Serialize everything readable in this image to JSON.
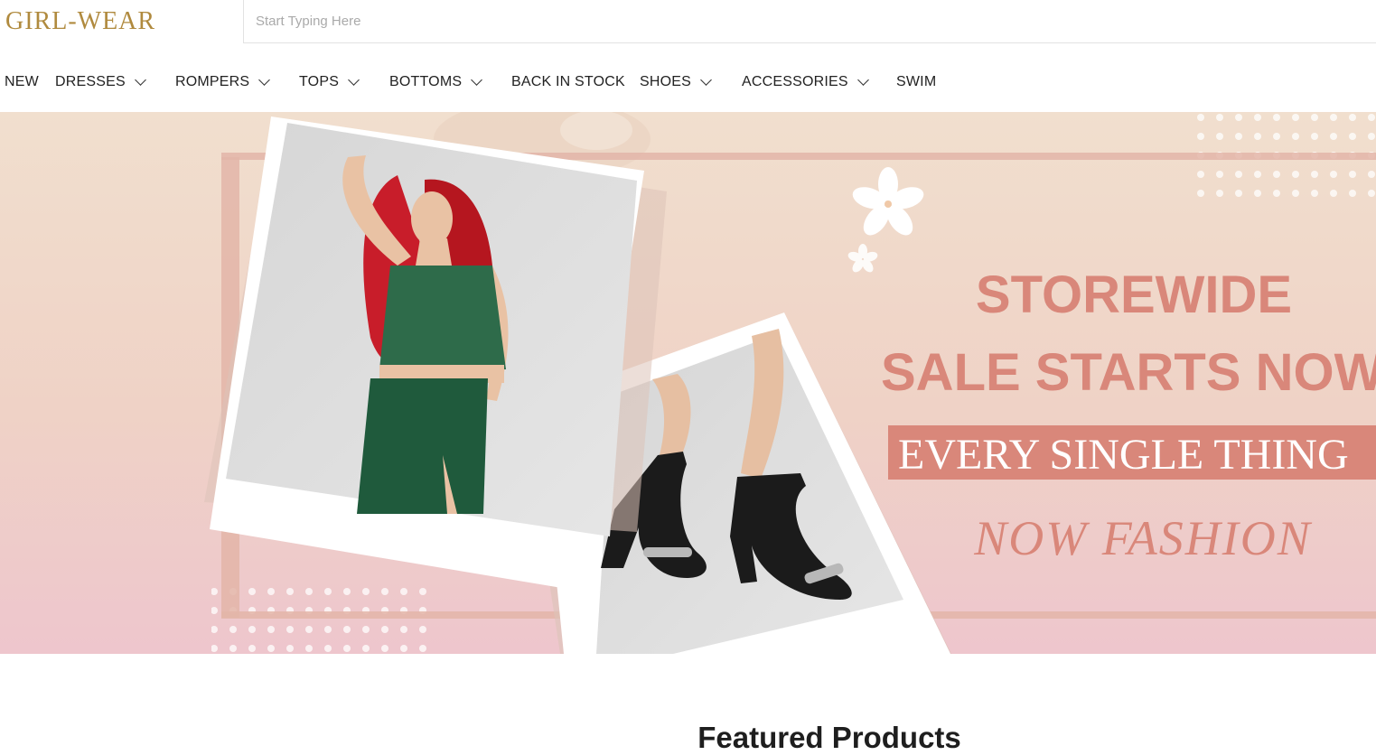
{
  "brand": {
    "logo_text": "GIRL-WEAR",
    "logo_color": "#b08a3e"
  },
  "search": {
    "placeholder": "Start Typing Here",
    "value": ""
  },
  "nav": {
    "items": [
      {
        "label": "NEW",
        "has_dropdown": false
      },
      {
        "label": "DRESSES",
        "has_dropdown": true
      },
      {
        "label": "ROMPERS",
        "has_dropdown": true
      },
      {
        "label": "TOPS",
        "has_dropdown": true
      },
      {
        "label": "BOTTOMS",
        "has_dropdown": true
      },
      {
        "label": "BACK IN STOCK",
        "has_dropdown": false
      },
      {
        "label": "SHOES",
        "has_dropdown": true
      },
      {
        "label": "ACCESSORIES",
        "has_dropdown": true
      },
      {
        "label": "SWIM",
        "has_dropdown": false
      }
    ]
  },
  "hero": {
    "headline_1": "STOREWIDE",
    "headline_2": "SALE STARTS NOW",
    "banner_text": "EVERY SINGLE THING",
    "script_text": "NOW FASHION",
    "colors": {
      "headline": "#d9877a",
      "banner_bg": "#d9877a",
      "banner_text": "#ffffff",
      "background": "#f0d8cc"
    }
  },
  "sections": {
    "featured_title": "Featured Products"
  }
}
